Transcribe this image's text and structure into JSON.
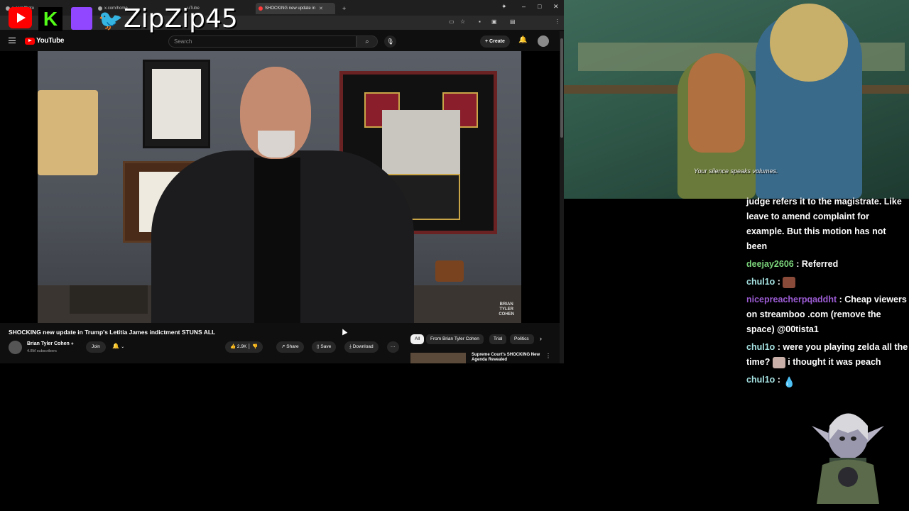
{
  "browser": {
    "tabs": [
      {
        "label": "x.com/theto"
      },
      {
        "label": "x.com/home"
      },
      {
        "label": "uTube"
      },
      {
        "label": "SHOCKING new update in"
      }
    ],
    "new_tab": "+",
    "window_controls": {
      "minimize": "–",
      "maximize": "□",
      "close": "✕"
    }
  },
  "youtube": {
    "logo": "YouTube",
    "search_placeholder": "Search",
    "create_label": "Create",
    "video": {
      "watermark": "BRIAN\nTYLER\nCOHEN",
      "title": "SHOCKING new update in Trump's Letitia James indictment STUNS ALL"
    },
    "channel": {
      "name": "Brian Tyler Cohen",
      "subscribers": "4.8M subscribers",
      "join_label": "Join"
    },
    "actions": {
      "likes": "2.9K",
      "share": "Share",
      "save": "Save",
      "download": "Download",
      "more": "···"
    },
    "chips": [
      "All",
      "From Brian Tyler Cohen",
      "Trial",
      "Politics"
    ],
    "recommendation": {
      "title": "Supreme Court's SHOCKING New Agenda Revealed"
    }
  },
  "overlay": {
    "streamer_name": "ZipZip45"
  },
  "game": {
    "subtitle": "Your silence speaks volumes."
  },
  "chat": {
    "messages": [
      {
        "user": "",
        "color": "#ffffff",
        "text": "judge refers it to the magistrate. Like leave to amend complaint for example. But this motion has not been"
      },
      {
        "user": "deejay2606",
        "color": "#7cd67c",
        "text": " : Referred"
      },
      {
        "user": "chul1o",
        "color": "#a7e3e3",
        "text": " : "
      },
      {
        "user": "nicepreacherpqaddht",
        "color": "#9c5cd4",
        "text": " : Cheap viewers on streamboo .com (remove the space) @00tista1"
      },
      {
        "user": "chul1o",
        "color": "#a7e3e3",
        "text": " : were you playing zelda all the time? "
      },
      {
        "user": "",
        "color": "#ffffff",
        "text": " i thought it was peach"
      },
      {
        "user": "chul1o",
        "color": "#a7e3e3",
        "text": " : "
      }
    ]
  }
}
